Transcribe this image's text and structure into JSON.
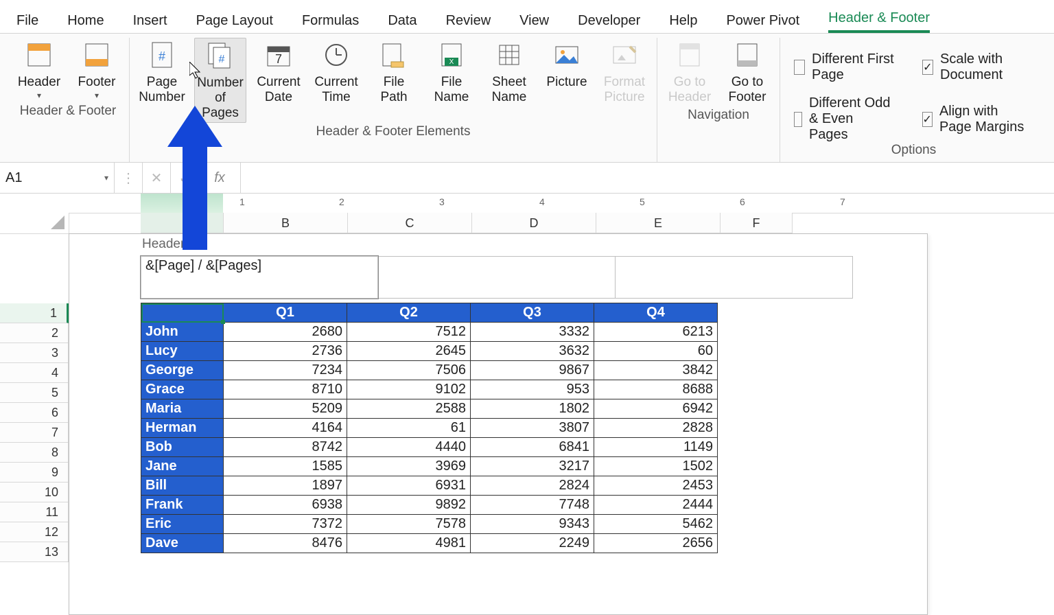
{
  "tabs": [
    "File",
    "Home",
    "Insert",
    "Page Layout",
    "Formulas",
    "Data",
    "Review",
    "View",
    "Developer",
    "Help",
    "Power Pivot",
    "Header & Footer"
  ],
  "active_tab": "Header & Footer",
  "groups": {
    "hf": {
      "label": "Header & Footer",
      "header": "Header",
      "footer": "Footer"
    },
    "elements": {
      "label": "Header & Footer Elements",
      "page_number": "Page\nNumber",
      "number_of_pages": "Number\nof Pages",
      "current_date": "Current\nDate",
      "current_time": "Current\nTime",
      "file_path": "File\nPath",
      "file_name": "File\nName",
      "sheet_name": "Sheet\nName",
      "picture": "Picture",
      "format_picture": "Format\nPicture"
    },
    "nav": {
      "label": "Navigation",
      "goto_header": "Go to\nHeader",
      "goto_footer": "Go to\nFooter"
    },
    "options": {
      "label": "Options",
      "diff_first": "Different First Page",
      "diff_oe": "Different Odd & Even Pages",
      "scale": "Scale with Document",
      "align": "Align with Page Margins",
      "checked": {
        "diff_first": false,
        "diff_oe": false,
        "scale": true,
        "align": true
      }
    }
  },
  "name_box": "A1",
  "fx_label": "fx",
  "ruler_marks": [
    "1",
    "2",
    "3",
    "4",
    "5",
    "6",
    "7"
  ],
  "columns": [
    "B",
    "C",
    "D",
    "E",
    "F"
  ],
  "col_widths": {
    "A": 120,
    "B": 180,
    "C": 180,
    "D": 180,
    "E": 180,
    "F": 104
  },
  "row_numbers": [
    "1",
    "2",
    "3",
    "4",
    "5",
    "6",
    "7",
    "8",
    "9",
    "10",
    "11",
    "12",
    "13"
  ],
  "header_section_label": "Header",
  "header_left": "&[Page] / &[Pages]",
  "table": {
    "headers": [
      "",
      "Q1",
      "Q2",
      "Q3",
      "Q4"
    ],
    "rows": [
      {
        "name": "John",
        "v": [
          2680,
          7512,
          3332,
          6213
        ]
      },
      {
        "name": "Lucy",
        "v": [
          2736,
          2645,
          3632,
          60
        ]
      },
      {
        "name": "George",
        "v": [
          7234,
          7506,
          9867,
          3842
        ]
      },
      {
        "name": "Grace",
        "v": [
          8710,
          9102,
          953,
          8688
        ]
      },
      {
        "name": "Maria",
        "v": [
          5209,
          2588,
          1802,
          6942
        ]
      },
      {
        "name": "Herman",
        "v": [
          4164,
          61,
          3807,
          2828
        ]
      },
      {
        "name": "Bob",
        "v": [
          8742,
          4440,
          6841,
          1149
        ]
      },
      {
        "name": "Jane",
        "v": [
          1585,
          3969,
          3217,
          1502
        ]
      },
      {
        "name": "Bill",
        "v": [
          1897,
          6931,
          2824,
          2453
        ]
      },
      {
        "name": "Frank",
        "v": [
          6938,
          9892,
          7748,
          2444
        ]
      },
      {
        "name": "Eric",
        "v": [
          7372,
          7578,
          9343,
          5462
        ]
      },
      {
        "name": "Dave",
        "v": [
          8476,
          4981,
          2249,
          2656
        ]
      }
    ]
  },
  "colors": {
    "accent": "#1a8a55",
    "table_blue": "#245fce",
    "arrow": "#1346d8"
  }
}
